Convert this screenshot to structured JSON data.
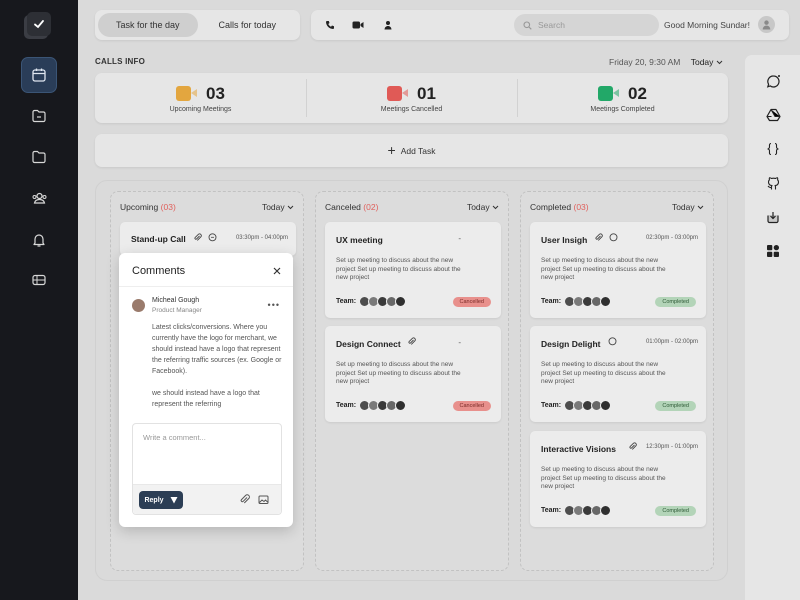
{
  "header": {
    "tabs": [
      "Task for the day",
      "Calls for today"
    ],
    "active_tab": 0,
    "search_placeholder": "Search",
    "greeting": "Good Morning Sundar!"
  },
  "sidebar": {
    "items": [
      "calendar-icon",
      "folder-icon",
      "folder-icon",
      "users-icon",
      "bell-icon",
      "ticket-icon"
    ],
    "active_index": 0
  },
  "calls_info": {
    "title": "CALLS INFO",
    "date": "Friday 20, 9:30 AM",
    "range": "Today",
    "stats": [
      {
        "count": "03",
        "label": "Upcoming Meetings",
        "color": "#e3a63f"
      },
      {
        "count": "01",
        "label": "Meetings Cancelled",
        "color": "#e05a56"
      },
      {
        "count": "02",
        "label": "Meetings Completed",
        "color": "#22a868"
      }
    ]
  },
  "add_task_label": "Add Task",
  "columns": [
    {
      "title": "Upcoming",
      "count": "(03)",
      "range": "Today",
      "cards": [
        {
          "title": "Stand-up Call",
          "time": "03:30pm - 04:00pm"
        }
      ]
    },
    {
      "title": "Canceled",
      "count": "(02)",
      "range": "Today",
      "cards": [
        {
          "title": "UX meeting",
          "time": "-",
          "desc": "Set up meeting to discuss about the new project Set up meeting to discuss about the new project",
          "team_label": "Team:",
          "status": "Cancelled"
        },
        {
          "title": "Design Connect",
          "time": "-",
          "desc": "Set up meeting to discuss about the new project Set up meeting to discuss about the new project",
          "team_label": "Team:",
          "status": "Cancelled"
        }
      ]
    },
    {
      "title": "Completed",
      "count": "(03)",
      "range": "Today",
      "cards": [
        {
          "title": "User Insigh",
          "time": "02:30pm - 03:00pm",
          "desc": "Set up meeting to discuss about the new project Set up meeting to discuss about the new project",
          "team_label": "Team:",
          "status": "Completed"
        },
        {
          "title": "Design Delight",
          "time": "01:00pm - 02:00pm",
          "desc": "Set up meeting to discuss about the new project Set up meeting to discuss about the new project",
          "team_label": "Team:",
          "status": "Completed"
        },
        {
          "title": "Interactive Visions",
          "time": "12:30pm - 01:00pm",
          "desc": "Set up meeting to discuss about the new project Set up meeting to discuss about the new project",
          "team_label": "Team:",
          "status": "Completed"
        }
      ]
    }
  ],
  "comments": {
    "title": "Comments",
    "author": "Micheal Gough",
    "role": "Product Manager",
    "paragraphs": [
      "Latest clicks/conversions. Where you currently have the logo for merchant, we should instead have a logo that represent the referring traffic sources (ex. Google or Facebook).",
      "we should instead have a logo that represent the referring"
    ],
    "input_placeholder": "Write a comment...",
    "reply_label": "Reply"
  },
  "right_rail": [
    "chat-icon",
    "drive-icon",
    "code-braces-icon",
    "github-icon",
    "download-icon",
    "apps-icon"
  ]
}
